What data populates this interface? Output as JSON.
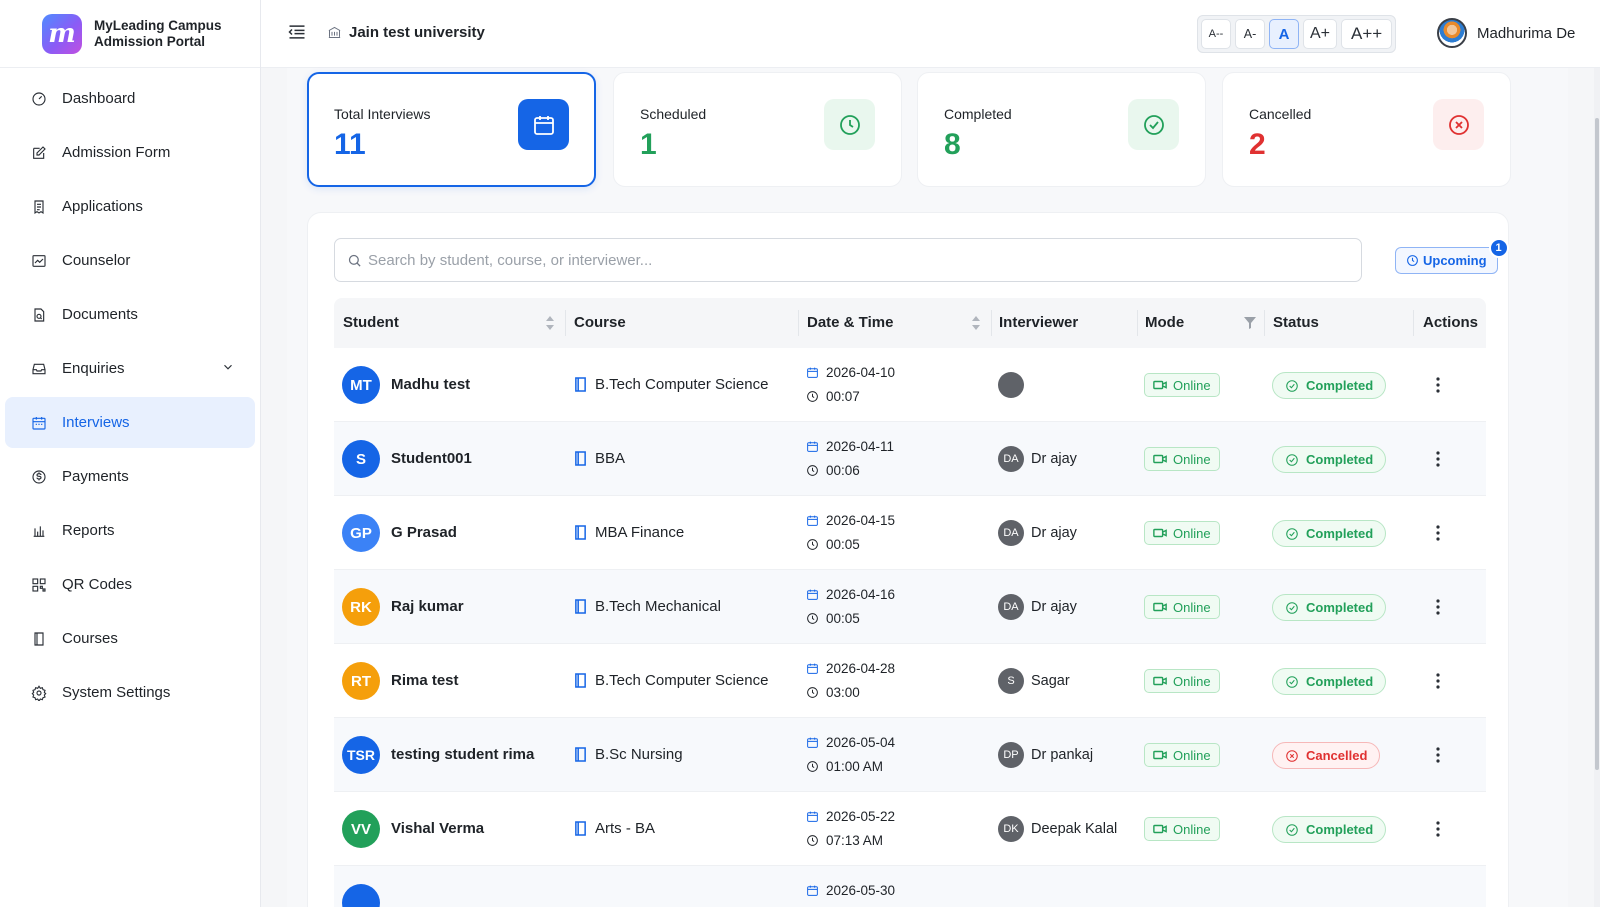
{
  "brand": {
    "name_line1": "MyLeading Campus",
    "name_line2": "Admission Portal",
    "logo_letter": "m"
  },
  "sidebar": {
    "items": [
      {
        "label": "Dashboard",
        "icon": "gauge-icon"
      },
      {
        "label": "Admission Form",
        "icon": "edit-icon"
      },
      {
        "label": "Applications",
        "icon": "receipt-icon"
      },
      {
        "label": "Counselor",
        "icon": "chart-line-icon"
      },
      {
        "label": "Documents",
        "icon": "file-search-icon"
      },
      {
        "label": "Enquiries",
        "icon": "inbox-icon"
      },
      {
        "label": "Interviews",
        "icon": "calendar-icon"
      },
      {
        "label": "Payments",
        "icon": "dollar-circle-icon"
      },
      {
        "label": "Reports",
        "icon": "bar-chart-icon"
      },
      {
        "label": "QR Codes",
        "icon": "qr-code-icon"
      },
      {
        "label": "Courses",
        "icon": "book-icon"
      },
      {
        "label": "System Settings",
        "icon": "gear-icon"
      }
    ],
    "active": "Interviews"
  },
  "header": {
    "university": "Jain test university",
    "font_sizes": [
      "A--",
      "A-",
      "A",
      "A+",
      "A++"
    ],
    "active_font": "A",
    "user_name": "Madhurima De"
  },
  "stats": {
    "total": {
      "label": "Total Interviews",
      "value": "11",
      "color": "#1565e6"
    },
    "scheduled": {
      "label": "Scheduled",
      "value": "1",
      "color": "#22a05a"
    },
    "completed": {
      "label": "Completed",
      "value": "8",
      "color": "#22a05a"
    },
    "cancelled": {
      "label": "Cancelled",
      "value": "2",
      "color": "#e03131"
    }
  },
  "search": {
    "placeholder": "Search by student, course, or interviewer..."
  },
  "filter": {
    "label": "Upcoming",
    "count": "1"
  },
  "table": {
    "columns": [
      "Student",
      "Course",
      "Date & Time",
      "Interviewer",
      "Mode",
      "Status",
      "Actions"
    ],
    "rows": [
      {
        "initials": "MT",
        "avatar_color": "#1565e6",
        "name": "Madhu test",
        "course": "B.Tech Computer Science",
        "date": "2026-04-10",
        "time": "00:07",
        "interviewer_initials": "",
        "interviewer": "",
        "mode": "Online",
        "status": "Completed"
      },
      {
        "initials": "S",
        "avatar_color": "#1565e6",
        "name": "Student001",
        "course": "BBA",
        "date": "2026-04-11",
        "time": "00:06",
        "interviewer_initials": "DA",
        "interviewer": "Dr ajay",
        "mode": "Online",
        "status": "Completed"
      },
      {
        "initials": "GP",
        "avatar_color": "#3b82f6",
        "name": "G Prasad",
        "course": "MBA Finance",
        "date": "2026-04-15",
        "time": "00:05",
        "interviewer_initials": "DA",
        "interviewer": "Dr ajay",
        "mode": "Online",
        "status": "Completed"
      },
      {
        "initials": "RK",
        "avatar_color": "#f59f0b",
        "name": "Raj kumar",
        "course": "B.Tech Mechanical",
        "date": "2026-04-16",
        "time": "00:05",
        "interviewer_initials": "DA",
        "interviewer": "Dr ajay",
        "mode": "Online",
        "status": "Completed"
      },
      {
        "initials": "RT",
        "avatar_color": "#f59f0b",
        "name": "Rima test",
        "course": "B.Tech Computer Science",
        "date": "2026-04-28",
        "time": "03:00",
        "interviewer_initials": "S",
        "interviewer": "Sagar",
        "mode": "Online",
        "status": "Completed"
      },
      {
        "initials": "TSR",
        "avatar_color": "#1565e6",
        "name": "testing student rima",
        "course": "B.Sc Nursing",
        "date": "2026-05-04",
        "time": "01:00 AM",
        "interviewer_initials": "DP",
        "interviewer": "Dr pankaj",
        "mode": "Online",
        "status": "Cancelled"
      },
      {
        "initials": "VV",
        "avatar_color": "#22a05a",
        "name": "Vishal Verma",
        "course": "Arts - BA",
        "date": "2026-05-22",
        "time": "07:13 AM",
        "interviewer_initials": "DK",
        "interviewer": "Deepak Kalal",
        "mode": "Online",
        "status": "Completed"
      },
      {
        "initials": "",
        "avatar_color": "#1565e6",
        "name": "",
        "course": "",
        "date": "2026-05-30",
        "time": "",
        "interviewer_initials": "",
        "interviewer": "",
        "mode": "",
        "status": ""
      }
    ]
  }
}
